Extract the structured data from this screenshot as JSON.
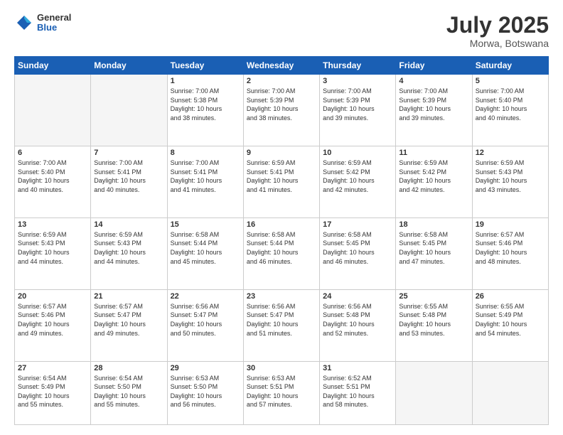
{
  "header": {
    "logo_general": "General",
    "logo_blue": "Blue",
    "month": "July 2025",
    "location": "Morwa, Botswana"
  },
  "days_of_week": [
    "Sunday",
    "Monday",
    "Tuesday",
    "Wednesday",
    "Thursday",
    "Friday",
    "Saturday"
  ],
  "weeks": [
    [
      {
        "day": "",
        "info": ""
      },
      {
        "day": "",
        "info": ""
      },
      {
        "day": "1",
        "info": "Sunrise: 7:00 AM\nSunset: 5:38 PM\nDaylight: 10 hours\nand 38 minutes."
      },
      {
        "day": "2",
        "info": "Sunrise: 7:00 AM\nSunset: 5:39 PM\nDaylight: 10 hours\nand 38 minutes."
      },
      {
        "day": "3",
        "info": "Sunrise: 7:00 AM\nSunset: 5:39 PM\nDaylight: 10 hours\nand 39 minutes."
      },
      {
        "day": "4",
        "info": "Sunrise: 7:00 AM\nSunset: 5:39 PM\nDaylight: 10 hours\nand 39 minutes."
      },
      {
        "day": "5",
        "info": "Sunrise: 7:00 AM\nSunset: 5:40 PM\nDaylight: 10 hours\nand 40 minutes."
      }
    ],
    [
      {
        "day": "6",
        "info": "Sunrise: 7:00 AM\nSunset: 5:40 PM\nDaylight: 10 hours\nand 40 minutes."
      },
      {
        "day": "7",
        "info": "Sunrise: 7:00 AM\nSunset: 5:41 PM\nDaylight: 10 hours\nand 40 minutes."
      },
      {
        "day": "8",
        "info": "Sunrise: 7:00 AM\nSunset: 5:41 PM\nDaylight: 10 hours\nand 41 minutes."
      },
      {
        "day": "9",
        "info": "Sunrise: 6:59 AM\nSunset: 5:41 PM\nDaylight: 10 hours\nand 41 minutes."
      },
      {
        "day": "10",
        "info": "Sunrise: 6:59 AM\nSunset: 5:42 PM\nDaylight: 10 hours\nand 42 minutes."
      },
      {
        "day": "11",
        "info": "Sunrise: 6:59 AM\nSunset: 5:42 PM\nDaylight: 10 hours\nand 42 minutes."
      },
      {
        "day": "12",
        "info": "Sunrise: 6:59 AM\nSunset: 5:43 PM\nDaylight: 10 hours\nand 43 minutes."
      }
    ],
    [
      {
        "day": "13",
        "info": "Sunrise: 6:59 AM\nSunset: 5:43 PM\nDaylight: 10 hours\nand 44 minutes."
      },
      {
        "day": "14",
        "info": "Sunrise: 6:59 AM\nSunset: 5:43 PM\nDaylight: 10 hours\nand 44 minutes."
      },
      {
        "day": "15",
        "info": "Sunrise: 6:58 AM\nSunset: 5:44 PM\nDaylight: 10 hours\nand 45 minutes."
      },
      {
        "day": "16",
        "info": "Sunrise: 6:58 AM\nSunset: 5:44 PM\nDaylight: 10 hours\nand 46 minutes."
      },
      {
        "day": "17",
        "info": "Sunrise: 6:58 AM\nSunset: 5:45 PM\nDaylight: 10 hours\nand 46 minutes."
      },
      {
        "day": "18",
        "info": "Sunrise: 6:58 AM\nSunset: 5:45 PM\nDaylight: 10 hours\nand 47 minutes."
      },
      {
        "day": "19",
        "info": "Sunrise: 6:57 AM\nSunset: 5:46 PM\nDaylight: 10 hours\nand 48 minutes."
      }
    ],
    [
      {
        "day": "20",
        "info": "Sunrise: 6:57 AM\nSunset: 5:46 PM\nDaylight: 10 hours\nand 49 minutes."
      },
      {
        "day": "21",
        "info": "Sunrise: 6:57 AM\nSunset: 5:47 PM\nDaylight: 10 hours\nand 49 minutes."
      },
      {
        "day": "22",
        "info": "Sunrise: 6:56 AM\nSunset: 5:47 PM\nDaylight: 10 hours\nand 50 minutes."
      },
      {
        "day": "23",
        "info": "Sunrise: 6:56 AM\nSunset: 5:47 PM\nDaylight: 10 hours\nand 51 minutes."
      },
      {
        "day": "24",
        "info": "Sunrise: 6:56 AM\nSunset: 5:48 PM\nDaylight: 10 hours\nand 52 minutes."
      },
      {
        "day": "25",
        "info": "Sunrise: 6:55 AM\nSunset: 5:48 PM\nDaylight: 10 hours\nand 53 minutes."
      },
      {
        "day": "26",
        "info": "Sunrise: 6:55 AM\nSunset: 5:49 PM\nDaylight: 10 hours\nand 54 minutes."
      }
    ],
    [
      {
        "day": "27",
        "info": "Sunrise: 6:54 AM\nSunset: 5:49 PM\nDaylight: 10 hours\nand 55 minutes."
      },
      {
        "day": "28",
        "info": "Sunrise: 6:54 AM\nSunset: 5:50 PM\nDaylight: 10 hours\nand 55 minutes."
      },
      {
        "day": "29",
        "info": "Sunrise: 6:53 AM\nSunset: 5:50 PM\nDaylight: 10 hours\nand 56 minutes."
      },
      {
        "day": "30",
        "info": "Sunrise: 6:53 AM\nSunset: 5:51 PM\nDaylight: 10 hours\nand 57 minutes."
      },
      {
        "day": "31",
        "info": "Sunrise: 6:52 AM\nSunset: 5:51 PM\nDaylight: 10 hours\nand 58 minutes."
      },
      {
        "day": "",
        "info": ""
      },
      {
        "day": "",
        "info": ""
      }
    ]
  ]
}
